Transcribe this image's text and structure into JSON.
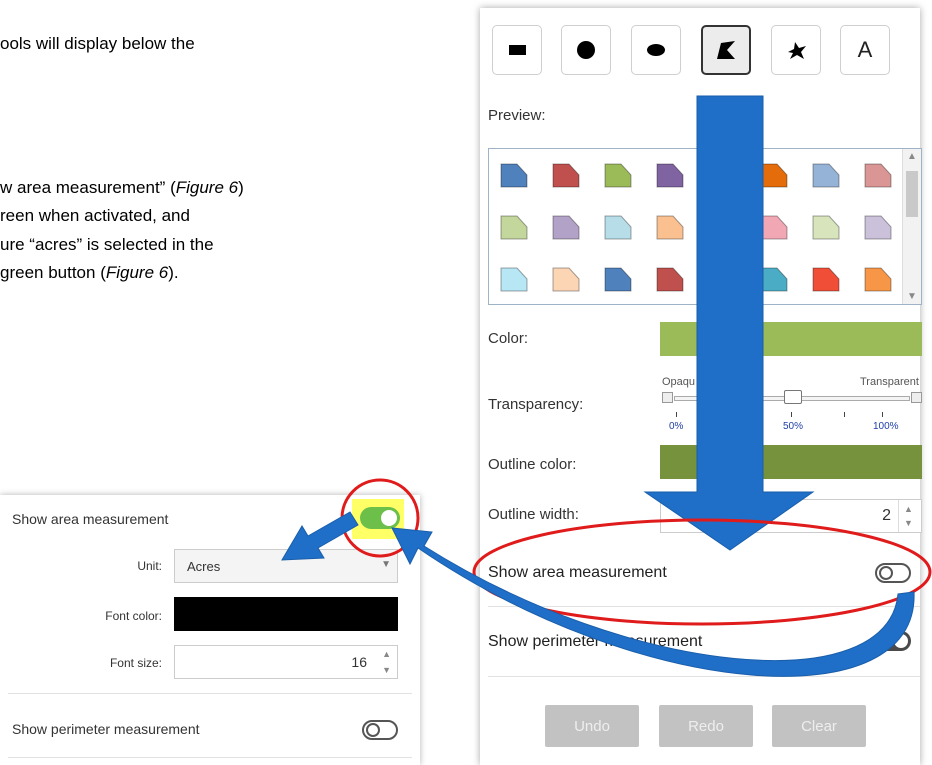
{
  "document": {
    "line1": "ools will display below the",
    "line2a": "w area measurement” (",
    "line2fig": "Figure 6",
    "line2b": ")",
    "line3": "reen when activated, and",
    "line4": "ure “acres” is selected in the",
    "line5a": " green button (",
    "line5fig": "Figure 6",
    "line5b": ")."
  },
  "toolbar": {
    "tools": [
      {
        "icon": "rectangle-icon"
      },
      {
        "icon": "circle-icon"
      },
      {
        "icon": "ellipse-icon"
      },
      {
        "icon": "polygon-icon",
        "selected": true
      },
      {
        "icon": "freehand-icon"
      },
      {
        "icon": "text-icon",
        "glyph": "A"
      }
    ]
  },
  "panel": {
    "preview_label": "Preview:",
    "color_label": "Color:",
    "transparency_label": "Transparency:",
    "transparency_opaque": "Opaqu",
    "transparency_transparent": "Transparent",
    "transparency_ticks": [
      "0%",
      "50%",
      "100%"
    ],
    "outline_color_label": "Outline color:",
    "outline_width_label": "Outline width:",
    "outline_width_value": "2",
    "show_area_label": "Show area measurement",
    "show_perimeter_label": "Show perimeter measurement",
    "undo_label": "Undo",
    "redo_label": "Redo",
    "clear_label": "Clear",
    "fill_color": "#9bbb59",
    "outline_color": "#76923c",
    "transparency_level": 0.5
  },
  "swatch_colors": [
    [
      "#4f81bd",
      "#c0504d",
      "#9bbb59",
      "#8064a2",
      "#ffffff",
      "#e46c0a",
      "#95b3d7",
      "#d99694"
    ],
    [
      "#c3d69b",
      "#b3a2c7",
      "#b7dee8",
      "#fac090",
      "#ffffff",
      "#f2a7b5",
      "#d7e4bc",
      "#ccc1da"
    ],
    [
      "#b7e6f5",
      "#fcd5b5",
      "#4f81bd",
      "#c0504d",
      "#ffffff",
      "#4bacc6",
      "#f04e37",
      "#f79646"
    ]
  ],
  "inset": {
    "show_area_label": "Show area measurement",
    "unit_label": "Unit:",
    "unit_value": "Acres",
    "font_color_label": "Font color:",
    "font_color": "#000000",
    "font_size_label": "Font size:",
    "font_size_value": "16",
    "show_perimeter_label": "Show perimeter measurement"
  },
  "annotation_colors": {
    "arrow_blue": "#1f6fc8",
    "ellipse_red": "#e01b1b",
    "highlight_yellow": "#ffff66"
  }
}
